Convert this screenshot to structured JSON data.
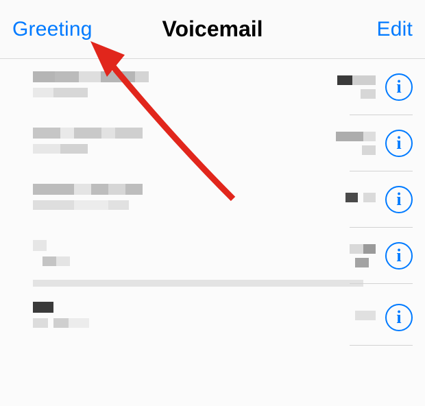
{
  "header": {
    "left_label": "Greeting",
    "title": "Voicemail",
    "right_label": "Edit"
  },
  "info_glyph": "i",
  "rows": [
    {
      "left_bars": [
        [
          [
            "#b5b5b5",
            32
          ],
          [
            "#bbbbbb",
            35
          ],
          [
            "#dedede",
            32
          ],
          [
            "#b6b6b6",
            50
          ],
          [
            "#d4d4d4",
            20
          ]
        ],
        [
          [
            "#e9e9e9",
            30
          ],
          [
            "#d7d7d7",
            50
          ]
        ]
      ],
      "right_bars": [
        [
          [
            "#3a3a3a",
            22
          ],
          [
            "#cfcfcf",
            34
          ]
        ],
        [
          [
            "#d7d7d7",
            22
          ]
        ]
      ]
    },
    {
      "left_bars": [
        [
          [
            "#c6c6c6",
            40
          ],
          [
            "#e9e9e9",
            20
          ],
          [
            "#c9c9c9",
            40
          ],
          [
            "#e2e2e2",
            20
          ],
          [
            "#cfcfcf",
            40
          ]
        ],
        [
          [
            "#e7e7e7",
            40
          ],
          [
            "#d2d2d2",
            40
          ]
        ]
      ],
      "right_bars": [
        [
          [
            "#adadad",
            40
          ],
          [
            "#dddddd",
            18
          ]
        ],
        [
          [
            "#d7d7d7",
            20
          ]
        ]
      ]
    },
    {
      "left_bars": [
        [
          [
            "#bcbcbc",
            60
          ],
          [
            "#e4e4e4",
            25
          ],
          [
            "#bdbdbd",
            25
          ],
          [
            "#d6d6d6",
            25
          ],
          [
            "#bdbdbd",
            25
          ]
        ],
        [
          [
            "#dedede",
            60
          ],
          [
            "#ececec",
            50
          ],
          [
            "#e1e1e1",
            30
          ]
        ]
      ],
      "right_bars": [
        [
          [
            "#4a4a4a",
            18
          ],
          [
            "#ffffff00",
            8
          ],
          [
            "#dadada",
            18
          ]
        ],
        []
      ]
    },
    {
      "left_bars": [
        [
          [
            "#e6e6e6",
            20
          ]
        ],
        [
          [
            "#ffffff00",
            14
          ],
          [
            "#c4c4c4",
            20
          ],
          [
            "#e4e4e4",
            20
          ]
        ]
      ],
      "right_bars": [
        [
          [
            "#d9d9d9",
            20
          ],
          [
            "#9a9a9a",
            18
          ]
        ],
        [
          [
            "#a3a3a3",
            20
          ],
          [
            "#ffffff00",
            10
          ]
        ]
      ],
      "full_bar": true
    },
    {
      "left_bars": [
        [
          [
            "#3a3a3a",
            30
          ]
        ],
        [
          [
            "#dcdcdc",
            22
          ],
          [
            "#ffffff00",
            8
          ],
          [
            "#cfcfcf",
            22
          ],
          [
            "#ececec",
            30
          ]
        ]
      ],
      "right_bars": [
        [
          [
            "#e0e0e0",
            30
          ]
        ],
        []
      ]
    }
  ]
}
